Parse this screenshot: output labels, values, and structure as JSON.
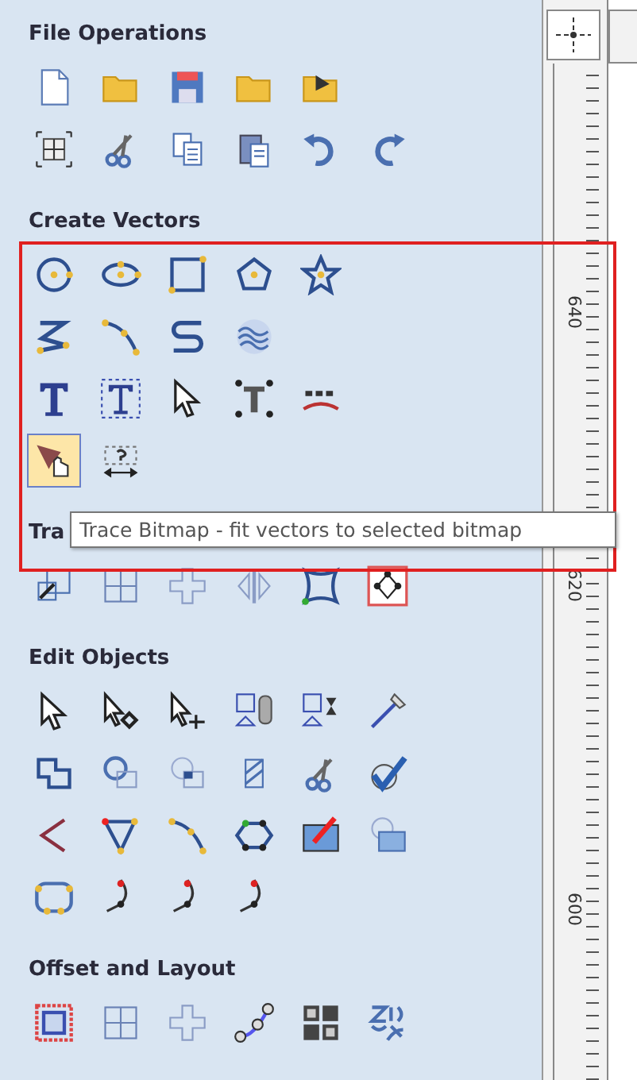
{
  "sections": [
    {
      "title": "File Operations",
      "rows": [
        [
          {
            "kind": "document",
            "selected": false
          },
          {
            "kind": "folder",
            "selected": false
          },
          {
            "kind": "floppy",
            "selected": false
          },
          {
            "kind": "folder",
            "selected": false
          },
          {
            "kind": "folder-arrow",
            "selected": false
          }
        ],
        [
          {
            "kind": "grid",
            "selected": false
          },
          {
            "kind": "scissors",
            "selected": false
          },
          {
            "kind": "copy",
            "selected": false
          },
          {
            "kind": "clipboard",
            "selected": false
          },
          {
            "kind": "undo",
            "selected": false
          },
          {
            "kind": "redo",
            "selected": false
          }
        ]
      ]
    },
    {
      "title": "Create Vectors",
      "rows": [
        [
          {
            "kind": "circle",
            "selected": false
          },
          {
            "kind": "ellipse",
            "selected": false
          },
          {
            "kind": "rectangle",
            "selected": false
          },
          {
            "kind": "pentagon",
            "selected": false
          },
          {
            "kind": "star",
            "selected": false
          }
        ],
        [
          {
            "kind": "zigzag",
            "selected": false
          },
          {
            "kind": "curve",
            "selected": false
          },
          {
            "kind": "s-curve",
            "selected": false
          },
          {
            "kind": "waves",
            "selected": false
          }
        ],
        [
          {
            "kind": "text",
            "selected": false
          },
          {
            "kind": "text-frame",
            "selected": false
          },
          {
            "kind": "pointer",
            "selected": false
          },
          {
            "kind": "text-handles",
            "selected": false
          },
          {
            "kind": "arc",
            "selected": false
          }
        ],
        [
          {
            "kind": "trace",
            "selected": true
          },
          {
            "kind": "dimension",
            "selected": false
          }
        ]
      ]
    },
    {
      "title": "Tra",
      "rows": [
        [
          {
            "kind": "squares",
            "selected": false
          },
          {
            "kind": "square-split",
            "selected": false
          },
          {
            "kind": "cross-squares",
            "selected": false
          },
          {
            "kind": "mirror",
            "selected": false
          },
          {
            "kind": "warp",
            "selected": false
          },
          {
            "kind": "node-box",
            "selected": false
          }
        ]
      ]
    },
    {
      "title": "Edit Objects",
      "rows": [
        [
          {
            "kind": "pointer",
            "selected": false
          },
          {
            "kind": "pointer-node",
            "selected": false
          },
          {
            "kind": "pointer-move",
            "selected": false
          },
          {
            "kind": "group",
            "selected": false
          },
          {
            "kind": "ungroup",
            "selected": false
          },
          {
            "kind": "measure",
            "selected": false
          }
        ],
        [
          {
            "kind": "weld",
            "selected": false
          },
          {
            "kind": "merge",
            "selected": false
          },
          {
            "kind": "subtract",
            "selected": false
          },
          {
            "kind": "hatch",
            "selected": false
          },
          {
            "kind": "scissors",
            "selected": false
          },
          {
            "kind": "check",
            "selected": false
          }
        ],
        [
          {
            "kind": "angle",
            "selected": false
          },
          {
            "kind": "triangle-nodes",
            "selected": false
          },
          {
            "kind": "curve",
            "selected": false
          },
          {
            "kind": "node-loop",
            "selected": false
          },
          {
            "kind": "image-edit",
            "selected": false
          },
          {
            "kind": "image",
            "selected": false
          }
        ],
        [
          {
            "kind": "node-rect",
            "selected": false
          },
          {
            "kind": "corner",
            "selected": false
          },
          {
            "kind": "corner",
            "selected": false
          },
          {
            "kind": "corner",
            "selected": false
          }
        ]
      ]
    },
    {
      "title": "Offset and Layout",
      "rows": [
        [
          {
            "kind": "offset",
            "selected": false
          },
          {
            "kind": "square-split",
            "selected": false
          },
          {
            "kind": "cross-squares",
            "selected": false
          },
          {
            "kind": "path-nodes",
            "selected": false
          },
          {
            "kind": "array",
            "selected": false
          },
          {
            "kind": "nest",
            "selected": false
          }
        ]
      ]
    }
  ],
  "tooltip": "Trace Bitmap - fit vectors to selected bitmap",
  "ruler": {
    "labels": [
      "640",
      "620",
      "600"
    ]
  }
}
